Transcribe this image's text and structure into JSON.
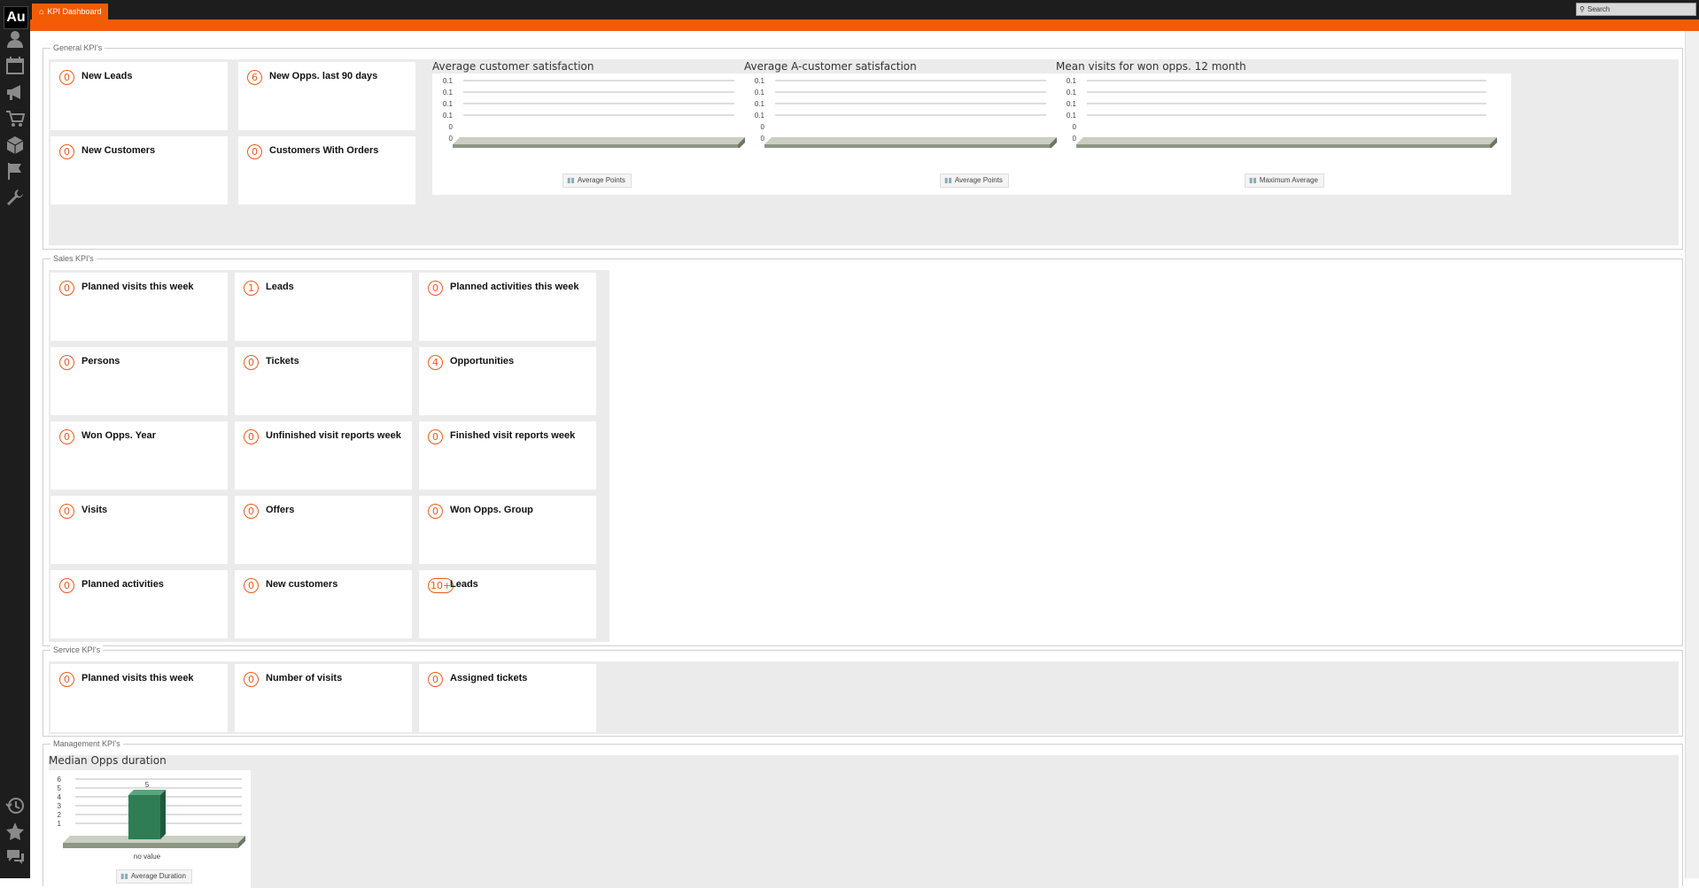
{
  "app": {
    "logo_text": "Au"
  },
  "tabs": [
    {
      "label": "KPI Dashboard",
      "icon": "home-icon"
    }
  ],
  "search": {
    "placeholder": "Search"
  },
  "sidebar": {
    "top_icons": [
      "person-icon",
      "calendar-icon",
      "megaphone-icon",
      "cart-icon",
      "box-icon",
      "flag-icon",
      "wrench-icon"
    ],
    "bottom_icons": [
      "history-icon",
      "star-icon",
      "chat-icon"
    ]
  },
  "colors": {
    "accent": "#f25c05",
    "sidebar_bg": "#1d1d1d",
    "kpi_number": "#e85a1f",
    "bar_green": "#2e7d55"
  },
  "sections": {
    "general": {
      "title": "General KPI's",
      "cards": [
        {
          "value": "0",
          "label": "New Leads"
        },
        {
          "value": "6",
          "label": "New Opps. last 90 days"
        },
        {
          "value": "0",
          "label": "New Customers"
        },
        {
          "value": "0",
          "label": "Customers With Orders"
        }
      ],
      "charts": [
        {
          "title": "Average customer satisfaction",
          "legend": "Average Points"
        },
        {
          "title": "Average A-customer satisfaction",
          "legend": "Average Points"
        },
        {
          "title": "Mean visits for won opps. 12 month",
          "legend": "Maximum Average"
        }
      ]
    },
    "sales": {
      "title": "Sales KPI's",
      "cards": [
        {
          "value": "0",
          "label": "Planned visits this week"
        },
        {
          "value": "1",
          "label": "Leads"
        },
        {
          "value": "0",
          "label": "Planned activities this week"
        },
        {
          "value": "0",
          "label": "Persons"
        },
        {
          "value": "0",
          "label": "Tickets"
        },
        {
          "value": "4",
          "label": "Opportunities"
        },
        {
          "value": "0",
          "label": "Won Opps. Year"
        },
        {
          "value": "0",
          "label": "Unfinished visit reports week"
        },
        {
          "value": "0",
          "label": "Finished visit reports week"
        },
        {
          "value": "0",
          "label": "Visits"
        },
        {
          "value": "0",
          "label": "Offers"
        },
        {
          "value": "0",
          "label": "Won Opps. Group"
        },
        {
          "value": "0",
          "label": "Planned activities"
        },
        {
          "value": "0",
          "label": "New customers"
        },
        {
          "value": "10+",
          "label": "Leads"
        }
      ]
    },
    "service": {
      "title": "Service KPI's",
      "cards": [
        {
          "value": "0",
          "label": "Planned visits this week"
        },
        {
          "value": "0",
          "label": "Number of visits"
        },
        {
          "value": "0",
          "label": "Assigned tickets"
        }
      ]
    },
    "management": {
      "title": "Management KPI's",
      "chart_title": "Median Opps duration",
      "legend": "Average Duration"
    }
  },
  "chart_data": [
    {
      "type": "bar",
      "title": "Average customer satisfaction",
      "yticks": [
        "0.1",
        "0.1",
        "0.1",
        "0.1",
        "0",
        "0"
      ],
      "categories": [],
      "series": [
        {
          "name": "Average Points",
          "values": []
        }
      ]
    },
    {
      "type": "bar",
      "title": "Average A-customer satisfaction",
      "yticks": [
        "0.1",
        "0.1",
        "0.1",
        "0.1",
        "0",
        "0"
      ],
      "categories": [],
      "series": [
        {
          "name": "Average Points",
          "values": []
        }
      ]
    },
    {
      "type": "bar",
      "title": "Mean visits for won opps. 12 month",
      "yticks": [
        "0.1",
        "0.1",
        "0.1",
        "0.1",
        "0",
        "0"
      ],
      "categories": [],
      "series": [
        {
          "name": "Maximum Average",
          "values": []
        }
      ]
    },
    {
      "type": "bar",
      "title": "Median Opps duration",
      "yticks": [
        "6",
        "5",
        "4",
        "3",
        "2",
        "1"
      ],
      "ylim": [
        0,
        6
      ],
      "categories": [
        "no value"
      ],
      "series": [
        {
          "name": "Average Duration",
          "values": [
            5
          ]
        }
      ],
      "data_labels": [
        "5"
      ]
    }
  ]
}
